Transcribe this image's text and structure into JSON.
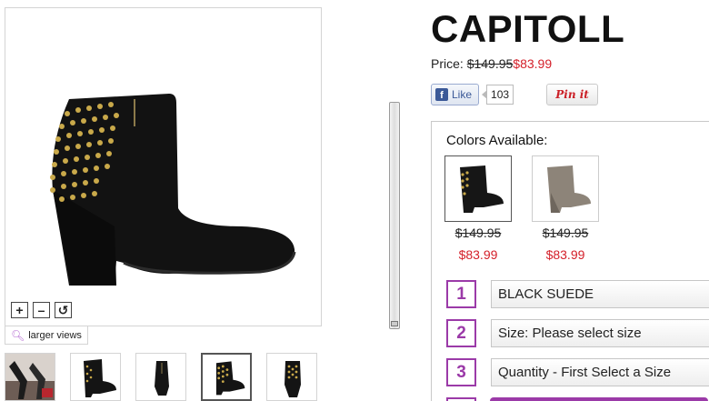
{
  "product": {
    "title": "CAPITOLL",
    "price_label": "Price:",
    "price_old": "$149.95",
    "price_new": "$83.99"
  },
  "viewer": {
    "zoom_in": "+",
    "zoom_out": "–",
    "reset": "↺",
    "larger_views": "larger views"
  },
  "social": {
    "like_label": "Like",
    "like_count": "103",
    "pin_label": "Pin it"
  },
  "colors": {
    "label": "Colors Available:",
    "swatches": [
      {
        "name": "black suede",
        "color": "#1a1a1a",
        "price_old": "$149.95",
        "price_new": "$83.99"
      },
      {
        "name": "taupe",
        "color": "#8d8479",
        "price_old": "$149.95",
        "price_new": "$83.99"
      }
    ]
  },
  "steps": [
    {
      "num": "1",
      "value": "BLACK SUEDE"
    },
    {
      "num": "2",
      "value": "Size: Please select size"
    },
    {
      "num": "3",
      "value": "Quantity - First Select a Size"
    }
  ],
  "theme": {
    "accent": "#9b3aa8",
    "sale_red": "#d4202a"
  }
}
